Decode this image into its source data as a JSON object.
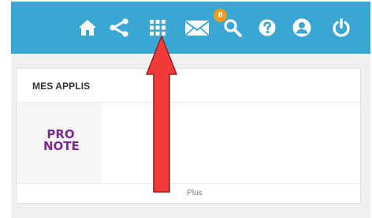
{
  "topbar": {
    "color": "#3aa6d4",
    "icons": [
      "home-icon",
      "share-icon",
      "apps-grid-icon",
      "mail-icon",
      "search-icon",
      "help-icon",
      "user-icon",
      "power-icon"
    ],
    "mail_badge": "8",
    "badge_color": "#f39a1d"
  },
  "apps_panel": {
    "title": "MES APPLIS",
    "apps": [
      {
        "name_line1": "PRO",
        "name_line2": "NOTE",
        "color": "#7a2c8c"
      }
    ],
    "more_label": "Plus"
  },
  "annotation": {
    "arrow_color": "#f23a3a",
    "points_to": "apps-grid-icon"
  }
}
